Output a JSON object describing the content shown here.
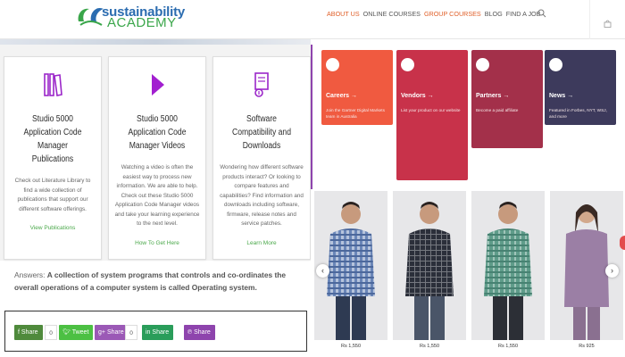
{
  "header": {
    "logo_top": "sustainability",
    "logo_bottom": "ACADEMY",
    "nav": [
      "ABOUT US",
      "ONLINE COURSES",
      "GROUP COURSES",
      "BLOG",
      "FIND A JOB"
    ],
    "active_nav": [
      "ABOUT US",
      "GROUP COURSES"
    ]
  },
  "cards": [
    {
      "title": "Studio 5000 Application Code Manager Publications",
      "text": "Check out Literature Library to find a wide collection of publications that support our different software offerings.",
      "link": "View Publications",
      "icon": "book-stack-icon"
    },
    {
      "title": "Studio 5000 Application Code Manager Videos",
      "text": "Watching a video is often the easiest way to process new information. We are able to help. Check out these Studio 5000 Application Code Manager videos and take your learning experience to the next level.",
      "link": "How To Get Here",
      "icon": "play-icon"
    },
    {
      "title": "Software Compatibility and Downloads",
      "text": "Wondering how different software products interact? Or looking to compare features and capabilities? Find information and downloads including software, firmware, release notes and service patches.",
      "link": "Learn More",
      "icon": "download-file-icon"
    }
  ],
  "answer": {
    "prefix": "Answers:",
    "text": "A collection of system programs that controls and co-ordinates the overall operations of a computer system is called Operating system."
  },
  "share": [
    {
      "label": "Share",
      "count": "0",
      "color": "#4f8a3c",
      "icon": "facebook-icon"
    },
    {
      "label": "Tweet",
      "count": "",
      "color": "#4cc043",
      "icon": "twitter-icon"
    },
    {
      "label": "Share",
      "count": "0",
      "color": "#9b59b6",
      "icon": "google-plus-icon"
    },
    {
      "label": "Share",
      "count": "",
      "color": "#2a9d5a",
      "icon": "linkedin-icon"
    },
    {
      "label": "Share",
      "count": "",
      "color": "#8e44ad",
      "icon": "pinterest-icon"
    }
  ],
  "tiles": [
    {
      "title": "Careers →",
      "text": "Join the Gartner Digital Markets team in Australia",
      "color": "#f05a40"
    },
    {
      "title": "Vendors →",
      "text": "List your product on our website",
      "color": "#c8324a"
    },
    {
      "title": "Partners →",
      "text": "Become a paid affiliate",
      "color": "#a3304a"
    },
    {
      "title": "News →",
      "text": "Featured in Forbes, NYT, WSJ, and more",
      "color": "#3d3a5c"
    }
  ],
  "products": [
    {
      "price": "Rs 1,550",
      "shirt": "#6a86b8"
    },
    {
      "price": "Rs 1,550",
      "shirt": "#2b2f3a"
    },
    {
      "price": "Rs 1,550",
      "shirt": "#5f9c8a"
    },
    {
      "price": "Rs 925",
      "shirt": "#9b7fa5"
    }
  ]
}
